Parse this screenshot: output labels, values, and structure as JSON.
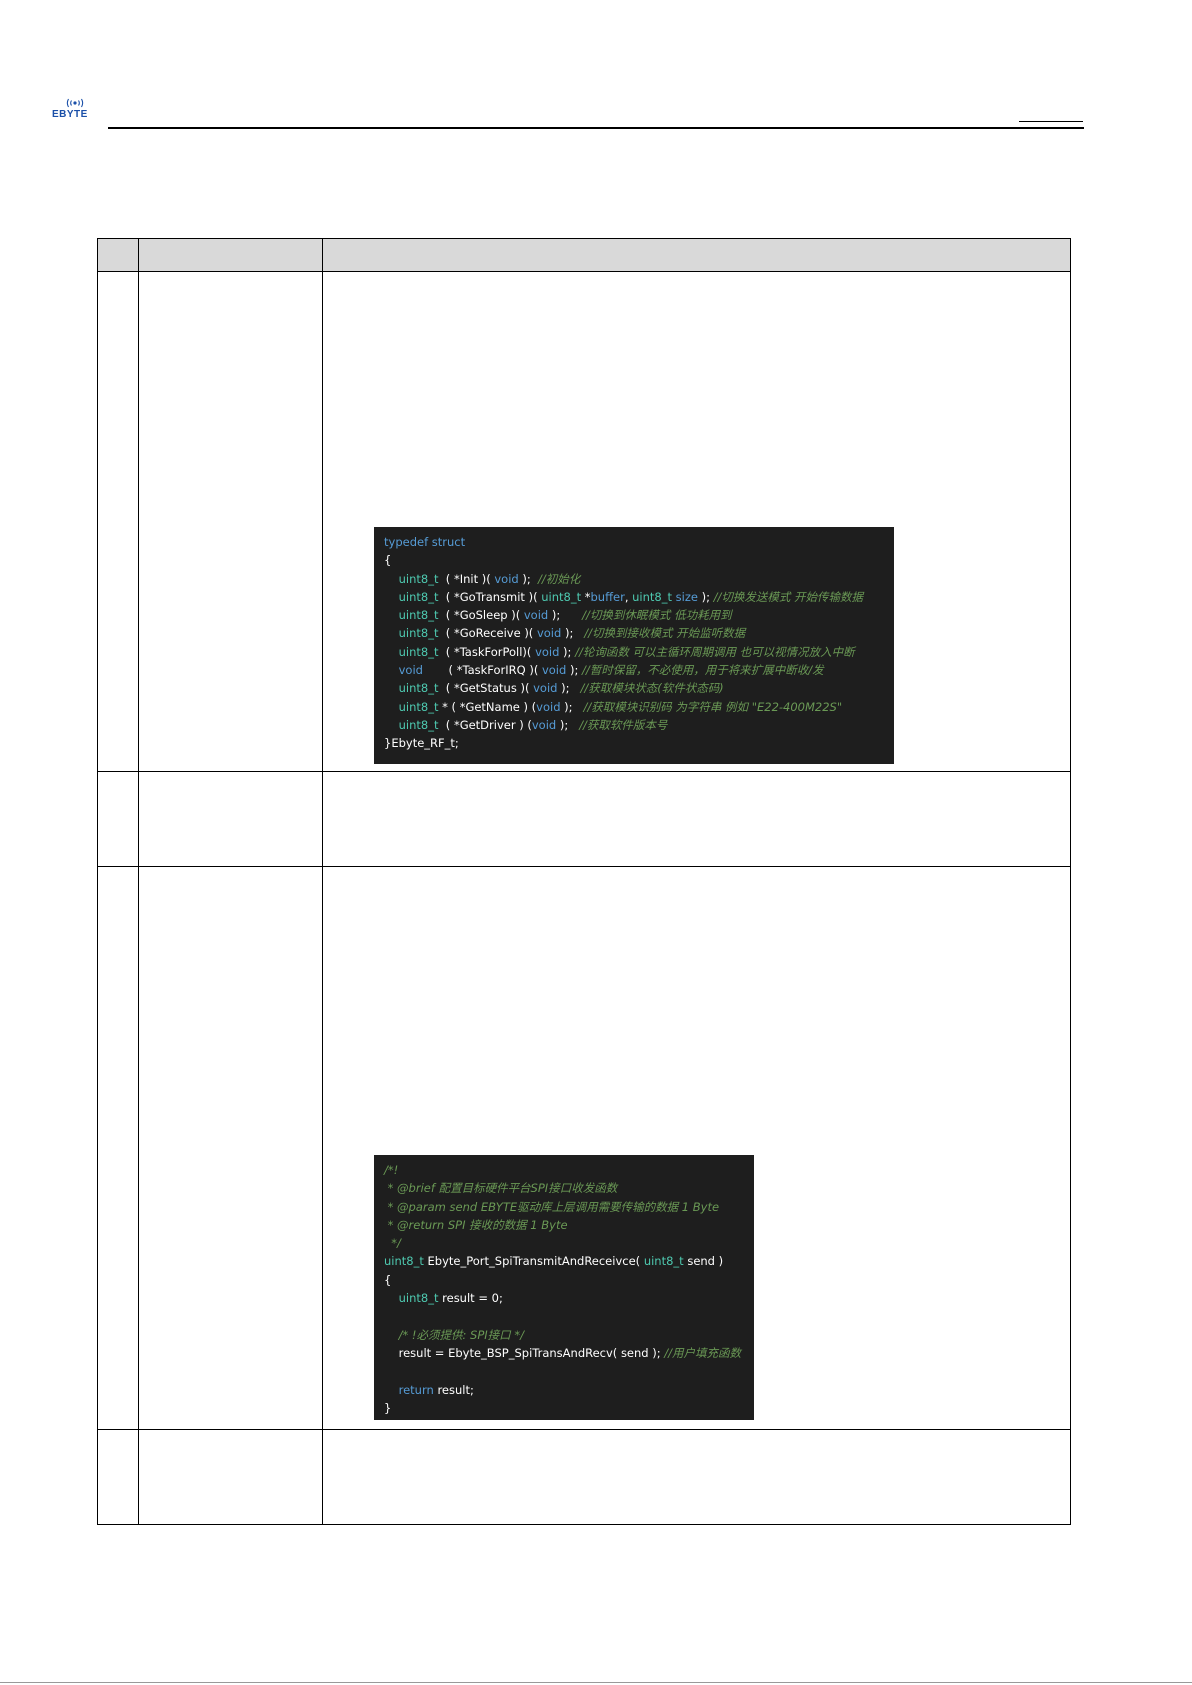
{
  "logo": {
    "text": "EBYTE",
    "brand_color": "#1a4fa8"
  },
  "code_block_1": {
    "lines": [
      [
        [
          "kw",
          "typedef struct"
        ]
      ],
      [
        [
          "pl",
          "{"
        ]
      ],
      [
        [
          "pl",
          "    "
        ],
        [
          "ty",
          "uint8_t"
        ],
        [
          "pl",
          "  ( *Init )( "
        ],
        [
          "kw",
          "void"
        ],
        [
          "pl",
          " );  "
        ],
        [
          "cm",
          "//初始化"
        ]
      ],
      [
        [
          "pl",
          "    "
        ],
        [
          "ty",
          "uint8_t"
        ],
        [
          "pl",
          "  ( *GoTransmit )( "
        ],
        [
          "ty",
          "uint8_t"
        ],
        [
          "pl",
          " *"
        ],
        [
          "kw",
          "buffer"
        ],
        [
          "pl",
          ", "
        ],
        [
          "ty",
          "uint8_t"
        ],
        [
          "pl",
          " "
        ],
        [
          "kw",
          "size"
        ],
        [
          "pl",
          " ); "
        ],
        [
          "cm",
          "//切换发送模式 开始传输数据"
        ]
      ],
      [
        [
          "pl",
          "    "
        ],
        [
          "ty",
          "uint8_t"
        ],
        [
          "pl",
          "  ( *GoSleep )( "
        ],
        [
          "kw",
          "void"
        ],
        [
          "pl",
          " );      "
        ],
        [
          "cm",
          "//切换到休眠模式 低功耗用到"
        ]
      ],
      [
        [
          "pl",
          "    "
        ],
        [
          "ty",
          "uint8_t"
        ],
        [
          "pl",
          "  ( *GoReceive )( "
        ],
        [
          "kw",
          "void"
        ],
        [
          "pl",
          " );   "
        ],
        [
          "cm",
          "//切换到接收模式 开始监听数据"
        ]
      ],
      [
        [
          "pl",
          "    "
        ],
        [
          "ty",
          "uint8_t"
        ],
        [
          "pl",
          "  ( *TaskForPoll)( "
        ],
        [
          "kw",
          "void"
        ],
        [
          "pl",
          " ); "
        ],
        [
          "cm",
          "//轮询函数 可以主循环周期调用 也可以视情况放入中断"
        ]
      ],
      [
        [
          "pl",
          "    "
        ],
        [
          "kw",
          "void"
        ],
        [
          "pl",
          "       ( *TaskForIRQ )( "
        ],
        [
          "kw",
          "void"
        ],
        [
          "pl",
          " ); "
        ],
        [
          "cm",
          "//暂时保留，不必使用，用于将来扩展中断收/发"
        ]
      ],
      [
        [
          "pl",
          "    "
        ],
        [
          "ty",
          "uint8_t"
        ],
        [
          "pl",
          "  ( *GetStatus )( "
        ],
        [
          "kw",
          "void"
        ],
        [
          "pl",
          " );   "
        ],
        [
          "cm",
          "//获取模块状态(软件状态码)"
        ]
      ],
      [
        [
          "pl",
          "    "
        ],
        [
          "ty",
          "uint8_t"
        ],
        [
          "pl",
          " * ( *GetName ) ("
        ],
        [
          "kw",
          "void"
        ],
        [
          "pl",
          " );   "
        ],
        [
          "cm",
          "//获取模块识别码 为字符串 例如 \"E22-400M22S\""
        ]
      ],
      [
        [
          "pl",
          "    "
        ],
        [
          "ty",
          "uint8_t"
        ],
        [
          "pl",
          "  ( *GetDriver ) ("
        ],
        [
          "kw",
          "void"
        ],
        [
          "pl",
          " );   "
        ],
        [
          "cm",
          "//获取软件版本号"
        ]
      ],
      [
        [
          "pl",
          "}Ebyte_RF_t;"
        ]
      ]
    ]
  },
  "code_block_2": {
    "lines": [
      [
        [
          "cm",
          "/*!"
        ]
      ],
      [
        [
          "cm",
          " * @brief 配置目标硬件平台SPI接口收发函数"
        ]
      ],
      [
        [
          "cm",
          " * @param send EBYTE驱动库上层调用需要传输的数据 1 Byte"
        ]
      ],
      [
        [
          "cm",
          " * @return SPI 接收的数据 1 Byte"
        ]
      ],
      [
        [
          "cm",
          "  */"
        ]
      ],
      [
        [
          "ty",
          "uint8_t"
        ],
        [
          "pl",
          " Ebyte_Port_SpiTransmitAndReceivce( "
        ],
        [
          "ty",
          "uint8_t"
        ],
        [
          "pl",
          " send )"
        ]
      ],
      [
        [
          "pl",
          "{"
        ]
      ],
      [
        [
          "pl",
          "    "
        ],
        [
          "ty",
          "uint8_t"
        ],
        [
          "pl",
          " result = 0;"
        ]
      ],
      [
        [
          "pl",
          " "
        ]
      ],
      [
        [
          "pl",
          "    "
        ],
        [
          "cm",
          "/* !必须提供: SPI接口 */"
        ]
      ],
      [
        [
          "pl",
          "    result = Ebyte_BSP_SpiTransAndRecv( send ); "
        ],
        [
          "cm",
          "//用户填充函数"
        ]
      ],
      [
        [
          "pl",
          " "
        ]
      ],
      [
        [
          "pl",
          "    "
        ],
        [
          "kw",
          "return"
        ],
        [
          "pl",
          " result;"
        ]
      ],
      [
        [
          "pl",
          "}"
        ]
      ]
    ]
  }
}
